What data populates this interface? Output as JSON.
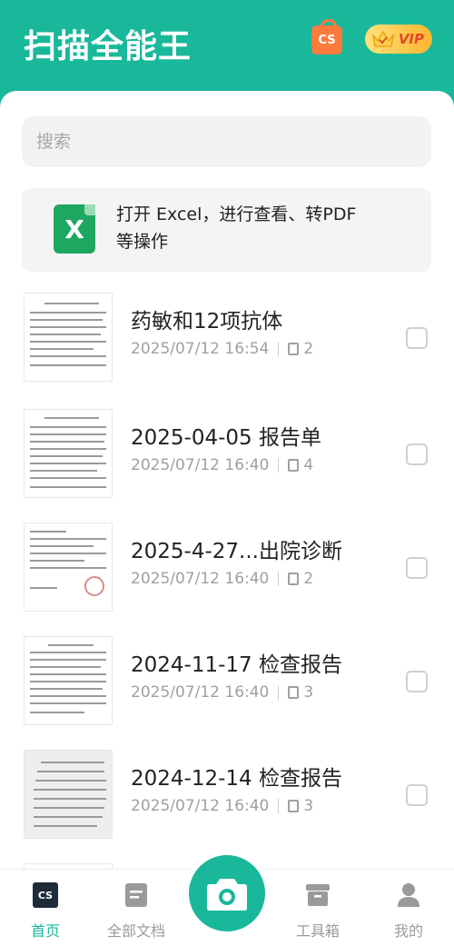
{
  "header": {
    "app_title": "扫描全能王",
    "cs_badge": "CS",
    "vip_badge": "VIP"
  },
  "search": {
    "placeholder": "搜索"
  },
  "excel_card": {
    "icon_letter": "X",
    "text": "打开 Excel，进行查看、转PDF 等操作"
  },
  "documents": [
    {
      "title": "药敏和12项抗体",
      "date": "2025/07/12 16:54",
      "pages": "2"
    },
    {
      "title": "2025-04-05 报告单",
      "date": "2025/07/12 16:40",
      "pages": "4"
    },
    {
      "title": "2025-4-27...出院诊断",
      "date": "2025/07/12 16:40",
      "pages": "2"
    },
    {
      "title": "2024-11-17 检查报告",
      "date": "2025/07/12 16:40",
      "pages": "3"
    },
    {
      "title": " 2024-12-14 检查报告",
      "date": "2025/07/12 16:40",
      "pages": "3"
    }
  ],
  "tabbar": {
    "home": "首页",
    "home_icon_text": "CS",
    "all_docs": "全部文档",
    "tools": "工具箱",
    "mine": "我的"
  },
  "colors": {
    "brand": "#19b89a",
    "excel": "#1ea761",
    "vip": "#ffb52e"
  }
}
